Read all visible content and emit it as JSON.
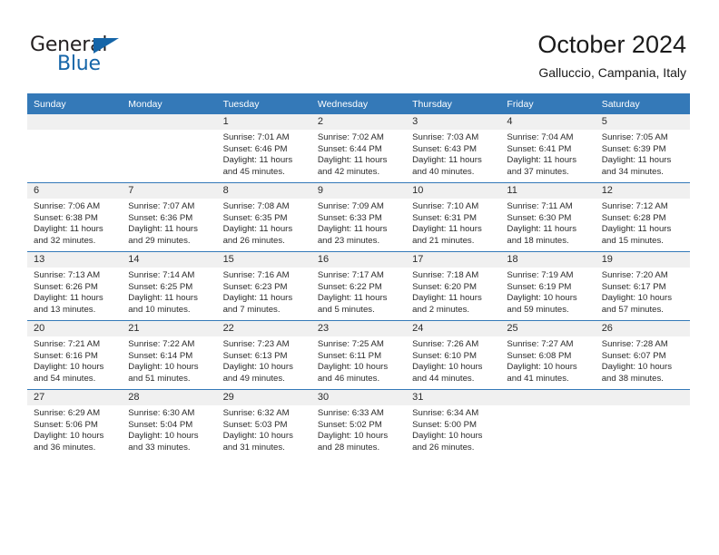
{
  "brand": {
    "name_top": "General",
    "name_bottom": "Blue",
    "accent_color": "#1565a8"
  },
  "header": {
    "title": "October 2024",
    "subtitle": "Galluccio, Campania, Italy"
  },
  "theme": {
    "header_row_bg": "#3479b8",
    "daynum_bg": "#f0f0f0",
    "grid_line": "#3479b8",
    "text": "#2b2b2b"
  },
  "weekdays": [
    "Sunday",
    "Monday",
    "Tuesday",
    "Wednesday",
    "Thursday",
    "Friday",
    "Saturday"
  ],
  "labels": {
    "sunrise_prefix": "Sunrise:",
    "sunset_prefix": "Sunset:",
    "daylight_prefix": "Daylight:"
  },
  "weeks": [
    [
      {
        "day": "",
        "empty": true
      },
      {
        "day": "",
        "empty": true
      },
      {
        "day": "1",
        "sunrise": "Sunrise: 7:01 AM",
        "sunset": "Sunset: 6:46 PM",
        "daylight1": "Daylight: 11 hours",
        "daylight2": "and 45 minutes."
      },
      {
        "day": "2",
        "sunrise": "Sunrise: 7:02 AM",
        "sunset": "Sunset: 6:44 PM",
        "daylight1": "Daylight: 11 hours",
        "daylight2": "and 42 minutes."
      },
      {
        "day": "3",
        "sunrise": "Sunrise: 7:03 AM",
        "sunset": "Sunset: 6:43 PM",
        "daylight1": "Daylight: 11 hours",
        "daylight2": "and 40 minutes."
      },
      {
        "day": "4",
        "sunrise": "Sunrise: 7:04 AM",
        "sunset": "Sunset: 6:41 PM",
        "daylight1": "Daylight: 11 hours",
        "daylight2": "and 37 minutes."
      },
      {
        "day": "5",
        "sunrise": "Sunrise: 7:05 AM",
        "sunset": "Sunset: 6:39 PM",
        "daylight1": "Daylight: 11 hours",
        "daylight2": "and 34 minutes."
      }
    ],
    [
      {
        "day": "6",
        "sunrise": "Sunrise: 7:06 AM",
        "sunset": "Sunset: 6:38 PM",
        "daylight1": "Daylight: 11 hours",
        "daylight2": "and 32 minutes."
      },
      {
        "day": "7",
        "sunrise": "Sunrise: 7:07 AM",
        "sunset": "Sunset: 6:36 PM",
        "daylight1": "Daylight: 11 hours",
        "daylight2": "and 29 minutes."
      },
      {
        "day": "8",
        "sunrise": "Sunrise: 7:08 AM",
        "sunset": "Sunset: 6:35 PM",
        "daylight1": "Daylight: 11 hours",
        "daylight2": "and 26 minutes."
      },
      {
        "day": "9",
        "sunrise": "Sunrise: 7:09 AM",
        "sunset": "Sunset: 6:33 PM",
        "daylight1": "Daylight: 11 hours",
        "daylight2": "and 23 minutes."
      },
      {
        "day": "10",
        "sunrise": "Sunrise: 7:10 AM",
        "sunset": "Sunset: 6:31 PM",
        "daylight1": "Daylight: 11 hours",
        "daylight2": "and 21 minutes."
      },
      {
        "day": "11",
        "sunrise": "Sunrise: 7:11 AM",
        "sunset": "Sunset: 6:30 PM",
        "daylight1": "Daylight: 11 hours",
        "daylight2": "and 18 minutes."
      },
      {
        "day": "12",
        "sunrise": "Sunrise: 7:12 AM",
        "sunset": "Sunset: 6:28 PM",
        "daylight1": "Daylight: 11 hours",
        "daylight2": "and 15 minutes."
      }
    ],
    [
      {
        "day": "13",
        "sunrise": "Sunrise: 7:13 AM",
        "sunset": "Sunset: 6:26 PM",
        "daylight1": "Daylight: 11 hours",
        "daylight2": "and 13 minutes."
      },
      {
        "day": "14",
        "sunrise": "Sunrise: 7:14 AM",
        "sunset": "Sunset: 6:25 PM",
        "daylight1": "Daylight: 11 hours",
        "daylight2": "and 10 minutes."
      },
      {
        "day": "15",
        "sunrise": "Sunrise: 7:16 AM",
        "sunset": "Sunset: 6:23 PM",
        "daylight1": "Daylight: 11 hours",
        "daylight2": "and 7 minutes."
      },
      {
        "day": "16",
        "sunrise": "Sunrise: 7:17 AM",
        "sunset": "Sunset: 6:22 PM",
        "daylight1": "Daylight: 11 hours",
        "daylight2": "and 5 minutes."
      },
      {
        "day": "17",
        "sunrise": "Sunrise: 7:18 AM",
        "sunset": "Sunset: 6:20 PM",
        "daylight1": "Daylight: 11 hours",
        "daylight2": "and 2 minutes."
      },
      {
        "day": "18",
        "sunrise": "Sunrise: 7:19 AM",
        "sunset": "Sunset: 6:19 PM",
        "daylight1": "Daylight: 10 hours",
        "daylight2": "and 59 minutes."
      },
      {
        "day": "19",
        "sunrise": "Sunrise: 7:20 AM",
        "sunset": "Sunset: 6:17 PM",
        "daylight1": "Daylight: 10 hours",
        "daylight2": "and 57 minutes."
      }
    ],
    [
      {
        "day": "20",
        "sunrise": "Sunrise: 7:21 AM",
        "sunset": "Sunset: 6:16 PM",
        "daylight1": "Daylight: 10 hours",
        "daylight2": "and 54 minutes."
      },
      {
        "day": "21",
        "sunrise": "Sunrise: 7:22 AM",
        "sunset": "Sunset: 6:14 PM",
        "daylight1": "Daylight: 10 hours",
        "daylight2": "and 51 minutes."
      },
      {
        "day": "22",
        "sunrise": "Sunrise: 7:23 AM",
        "sunset": "Sunset: 6:13 PM",
        "daylight1": "Daylight: 10 hours",
        "daylight2": "and 49 minutes."
      },
      {
        "day": "23",
        "sunrise": "Sunrise: 7:25 AM",
        "sunset": "Sunset: 6:11 PM",
        "daylight1": "Daylight: 10 hours",
        "daylight2": "and 46 minutes."
      },
      {
        "day": "24",
        "sunrise": "Sunrise: 7:26 AM",
        "sunset": "Sunset: 6:10 PM",
        "daylight1": "Daylight: 10 hours",
        "daylight2": "and 44 minutes."
      },
      {
        "day": "25",
        "sunrise": "Sunrise: 7:27 AM",
        "sunset": "Sunset: 6:08 PM",
        "daylight1": "Daylight: 10 hours",
        "daylight2": "and 41 minutes."
      },
      {
        "day": "26",
        "sunrise": "Sunrise: 7:28 AM",
        "sunset": "Sunset: 6:07 PM",
        "daylight1": "Daylight: 10 hours",
        "daylight2": "and 38 minutes."
      }
    ],
    [
      {
        "day": "27",
        "sunrise": "Sunrise: 6:29 AM",
        "sunset": "Sunset: 5:06 PM",
        "daylight1": "Daylight: 10 hours",
        "daylight2": "and 36 minutes."
      },
      {
        "day": "28",
        "sunrise": "Sunrise: 6:30 AM",
        "sunset": "Sunset: 5:04 PM",
        "daylight1": "Daylight: 10 hours",
        "daylight2": "and 33 minutes."
      },
      {
        "day": "29",
        "sunrise": "Sunrise: 6:32 AM",
        "sunset": "Sunset: 5:03 PM",
        "daylight1": "Daylight: 10 hours",
        "daylight2": "and 31 minutes."
      },
      {
        "day": "30",
        "sunrise": "Sunrise: 6:33 AM",
        "sunset": "Sunset: 5:02 PM",
        "daylight1": "Daylight: 10 hours",
        "daylight2": "and 28 minutes."
      },
      {
        "day": "31",
        "sunrise": "Sunrise: 6:34 AM",
        "sunset": "Sunset: 5:00 PM",
        "daylight1": "Daylight: 10 hours",
        "daylight2": "and 26 minutes."
      },
      {
        "day": "",
        "empty": true
      },
      {
        "day": "",
        "empty": true
      }
    ]
  ]
}
